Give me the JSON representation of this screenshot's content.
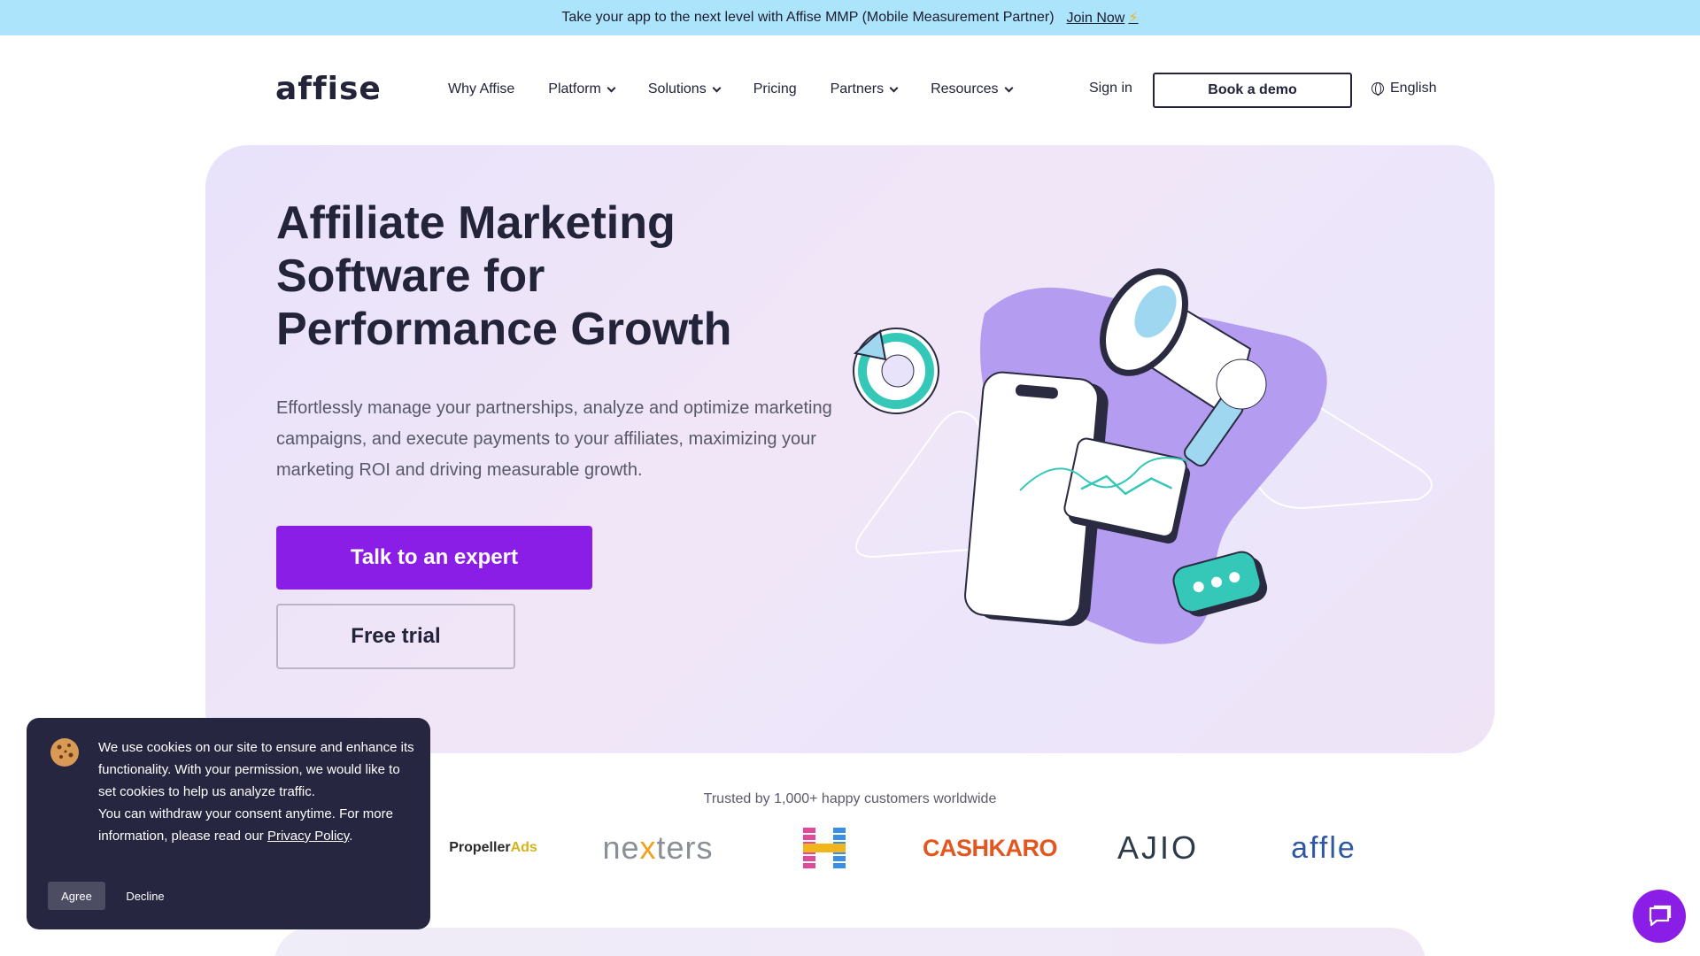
{
  "announcement": {
    "text": "Take your app to the next level with Affise MMP (Mobile Measurement Partner)",
    "link_label": "Join Now",
    "bolt_icon": "⚡"
  },
  "header": {
    "logo_text": "affise",
    "nav": [
      {
        "label": "Why Affise",
        "has_dropdown": false
      },
      {
        "label": "Platform",
        "has_dropdown": true
      },
      {
        "label": "Solutions",
        "has_dropdown": true
      },
      {
        "label": "Pricing",
        "has_dropdown": false
      },
      {
        "label": "Partners",
        "has_dropdown": true
      },
      {
        "label": "Resources",
        "has_dropdown": true
      }
    ],
    "sign_in": "Sign in",
    "demo_button": "Book a demo",
    "language": "English"
  },
  "hero": {
    "title_lines": [
      "Affiliate Marketing",
      "Software for",
      "Performance Growth"
    ],
    "description": "Effortlessly manage your partnerships, analyze and optimize marketing campaigns, and execute payments to your affiliates, maximizing your marketing ROI and driving measurable growth.",
    "cta_primary": "Talk to an expert",
    "cta_secondary": "Free trial"
  },
  "trusted": {
    "caption": "Trusted by 1,000+ happy customers worldwide",
    "logos": {
      "propeller": "Propeller",
      "propeller_ads": "Ads",
      "nexters_pre": "ne",
      "nexters_x": "x",
      "nexters_post": "ters",
      "cashkaro": "CASHKARO",
      "ajio": "AJIO",
      "affle": "affle"
    }
  },
  "cookie": {
    "text": "We use cookies on our site to ensure and enhance its functionality. With your permission, we would like to set cookies to help us analyze traffic.",
    "text2_prefix": "You can withdraw your consent anytime. For more information, please read our ",
    "policy_link": "Privacy Policy",
    "text2_suffix": ".",
    "agree": "Agree",
    "decline": "Decline"
  },
  "colors": {
    "accent": "#8a1ee6",
    "announce_bg": "#ace4fb",
    "dark": "#23233a",
    "cookie_bg": "#262641"
  }
}
